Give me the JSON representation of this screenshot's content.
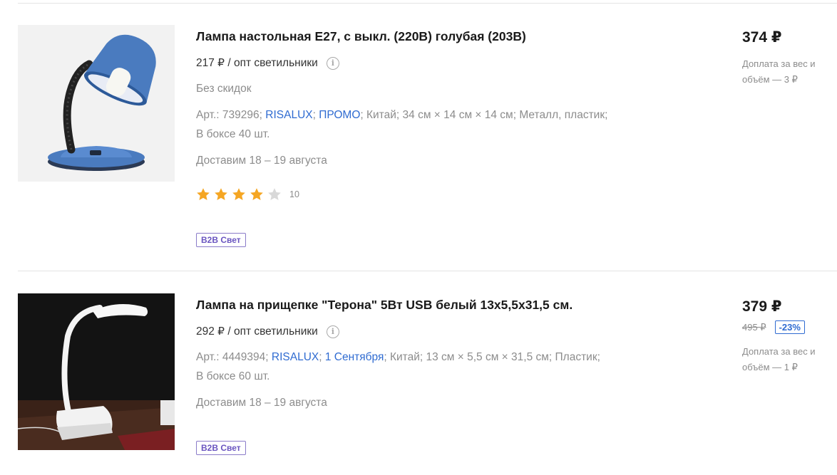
{
  "products": [
    {
      "title": "Лампа настольная Е27, с выкл. (220В) голубая (203B)",
      "wholesale_price": "217 ₽ / опт светильники",
      "no_discount": "Без скидок",
      "specs": {
        "art_prefix": "Арт.: 739296;",
        "brand": "RISALUX",
        "sep1": ";",
        "promo": "ПРОМО",
        "rest": "; Китай; 34 см × 14 см × 14 см; Металл, пластик;",
        "box": "В боксе 40 шт."
      },
      "delivery": "Доставим 18 – 19 августа",
      "rating": {
        "value": 4,
        "max": 5,
        "count": "10"
      },
      "badge": "B2B Свет",
      "price": "374 ₽",
      "surcharge": "Доплата за вес и объём — 3 ₽",
      "image_icon": "blue-desk-lamp"
    },
    {
      "title": "Лампа на прищепке \"Терона\" 5Вт USB белый 13х5,5х31,5 см.",
      "wholesale_price": "292 ₽ / опт светильники",
      "specs": {
        "art_prefix": "Арт.: 4449394;",
        "brand": "RISALUX",
        "sep1": ";",
        "promo": "1 Сентября",
        "rest": "; Китай; 13 см × 5,5 см × 31,5 см; Пластик;",
        "box": "В боксе 60 шт."
      },
      "delivery": "Доставим 18 – 19 августа",
      "badge": "B2B Свет",
      "price": "379 ₽",
      "old_price": "495 ₽",
      "discount": "-23%",
      "surcharge": "Доплата за вес и объём — 1 ₽",
      "image_icon": "white-clip-lamp"
    }
  ],
  "colors": {
    "link": "#2f6bd1",
    "badge": "#6a55c0",
    "star": "#f5a623",
    "star_empty": "#d8d8d8"
  }
}
